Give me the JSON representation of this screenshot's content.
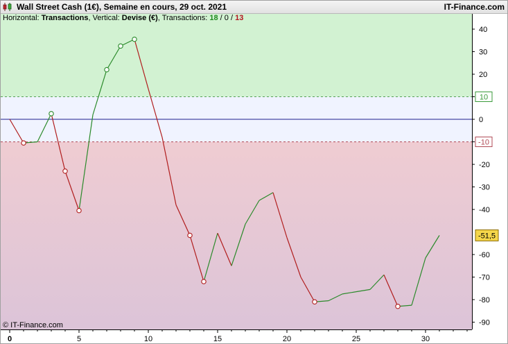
{
  "window": {
    "title": "Wall Street Cash (1€), Semaine en cours, 29 oct. 2021",
    "brand": "IT-Finance.com",
    "copyright": "© IT-Finance.com"
  },
  "info": {
    "horizontal_label": "Horizontal: ",
    "horizontal_value": "Transactions",
    "vertical_label": ", Vertical: ",
    "vertical_value": "Devise (€)",
    "transactions_label": ", Transactions: ",
    "winning": "18",
    "sep1": " / ",
    "neutral": "0",
    "sep2": " / ",
    "losing": "13"
  },
  "colors": {
    "up": "#2a8a2a",
    "down": "#b01c1c",
    "zone_green": "#d2f2d2",
    "zone_neutral": "#f0f3ff",
    "zone_red_top": "#efccd2",
    "zone_red_bottom": "#dcc4d8",
    "zero_line": "#1c1c8c",
    "last_value_badge": "#f5d64a"
  },
  "chart_data": {
    "type": "line",
    "title": "",
    "xlabel": "",
    "ylabel": "",
    "xlim": [
      0,
      33.5
    ],
    "ylim": [
      -95,
      44
    ],
    "x_ticks": [
      0,
      5,
      10,
      15,
      20,
      25,
      30
    ],
    "y_ticks": [
      40,
      30,
      20,
      10,
      0,
      -10,
      -20,
      -30,
      -40,
      -60,
      -70,
      -80,
      -90
    ],
    "threshold_upper": 10,
    "threshold_lower": -10,
    "threshold_upper_label": "10",
    "threshold_lower_label": "-10",
    "last_value_label": "-51,5",
    "series": [
      {
        "x": [
          0,
          1,
          2,
          3,
          4,
          5,
          6,
          7,
          8,
          9,
          10,
          11,
          12,
          13,
          14,
          15,
          16,
          17,
          18,
          19,
          20,
          21,
          22,
          23,
          24,
          25,
          26,
          27,
          28,
          29,
          30,
          31
        ],
        "values": [
          0,
          -10.5,
          -10,
          2.5,
          -23,
          -40.5,
          2,
          22,
          32.5,
          35.5,
          13.5,
          -8,
          -38,
          -51.5,
          -72,
          -50.5,
          -65,
          -46.5,
          -36,
          -32.5,
          -52.5,
          -70,
          -81,
          -80.5,
          -77.5,
          -76.5,
          -75.5,
          -69,
          -83,
          -82.5,
          -61.5,
          -51.5
        ],
        "markers": [
          1,
          3,
          4,
          5,
          7,
          8,
          9,
          13,
          14,
          22,
          28
        ]
      }
    ]
  }
}
